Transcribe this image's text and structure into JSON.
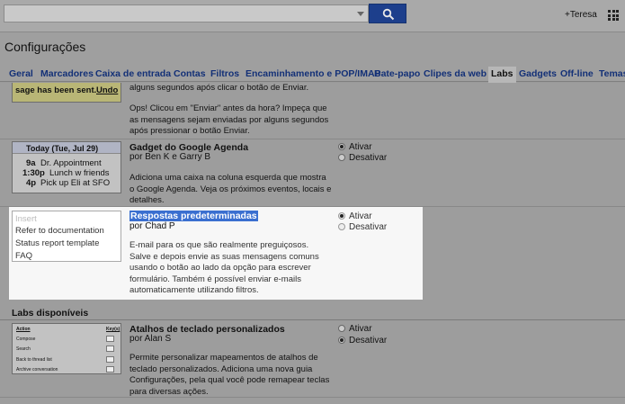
{
  "topbar": {
    "user": "+Teresa"
  },
  "page_title": "Configurações",
  "tabs": [
    "Geral",
    "Marcadores",
    "Caixa de entrada",
    "Contas",
    "Filtros",
    "Encaminhamento e POP/IMAP",
    "Bate-papo",
    "Clipes da web",
    "Labs",
    "Gadgets",
    "Off-line",
    "Temas"
  ],
  "features": [
    {
      "id": "undo",
      "thumb_text": "sage has been sent.",
      "thumb_link": "Undo",
      "desc_top": "alguns segundos após clicar o botão de Enviar.",
      "desc": "Ops! Clicou em \"Enviar\" antes da hora? Impeça que as mensagens sejam enviadas por alguns segundos após pressionar o botão Enviar."
    },
    {
      "id": "calendar",
      "thumb_header": "Today (Tue, Jul 29)",
      "thumb_events": [
        {
          "time": "9a",
          "text": "Dr. Appointment"
        },
        {
          "time": "1:30p",
          "text": "Lunch w friends"
        },
        {
          "time": "4p",
          "text": "Pick up Eli at SFO"
        }
      ],
      "title": "Gadget do Google Agenda",
      "author": "por Ben K e Garry B",
      "desc": "Adiciona uma caixa na coluna esquerda que mostra o Google Agenda. Veja os próximos eventos, locais e detalhes.",
      "enable": "Ativar",
      "disable": "Desativar"
    },
    {
      "id": "canned",
      "thumb_items": [
        "Insert",
        "Refer to documentation",
        "Status report template",
        "FAQ"
      ],
      "title": "Respostas predeterminadas",
      "author": "por Chad P",
      "desc": "E-mail para os que são realmente preguiçosos. Salve e depois envie as suas mensagens comuns usando o botão ao lado da opção para escrever formulário. Também é possível enviar e-mails automaticamente utilizando filtros.",
      "enable": "Ativar",
      "disable": "Desativar"
    }
  ],
  "available_section": "Labs disponíveis",
  "available": [
    {
      "id": "shortcuts",
      "thumb_header": [
        "Action",
        "Key(s)"
      ],
      "thumb_rows": [
        "Compose",
        "Search",
        "Back to thread list",
        "Archive conversation"
      ],
      "title": "Atalhos de teclado personalizados",
      "author": "por Alan S",
      "desc": "Permite personalizar mapeamentos de atalhos de teclado personalizados. Adiciona uma nova guia Configurações, pela qual você pode remapear teclas para diversas ações.",
      "enable": "Ativar",
      "disable": "Desativar"
    }
  ]
}
